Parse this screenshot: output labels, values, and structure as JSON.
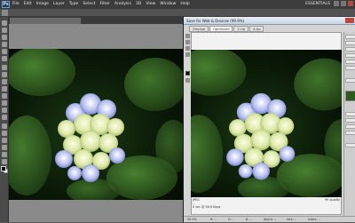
{
  "app": {
    "logo": "Ps",
    "menu": [
      "File",
      "Edit",
      "Image",
      "Layer",
      "Type",
      "Select",
      "Filter",
      "Analysis",
      "3D",
      "View",
      "Window",
      "Help"
    ],
    "workspace": "ESSENTIALS"
  },
  "options_bar": {
    "label": ""
  },
  "document": {
    "tab_label": ""
  },
  "dialog": {
    "title": "Save for Web & Devices (99.9%)",
    "tabs": [
      "Original",
      "Optimized",
      "2-Up",
      "4-Up"
    ],
    "active_tab": "Optimized",
    "info_left": "JPEG\n--\n0 sec @ 56.6 Kbps",
    "info_right": "99 quality",
    "bottom": {
      "zoom": "99.9%",
      "r": "R: --",
      "g": "G: --",
      "b": "B: --",
      "alpha": "Alpha: --",
      "hex": "Hex: --",
      "index": "Index: --"
    }
  },
  "colors": {
    "ps_dark": "#3c3c3c",
    "canvas_bg": "#8a8a8a",
    "dialog_bg": "#d4d4d4",
    "leaf": "#2f5a1e",
    "petal_blue": "#9aa6e0",
    "petal_green": "#d6e49a"
  }
}
